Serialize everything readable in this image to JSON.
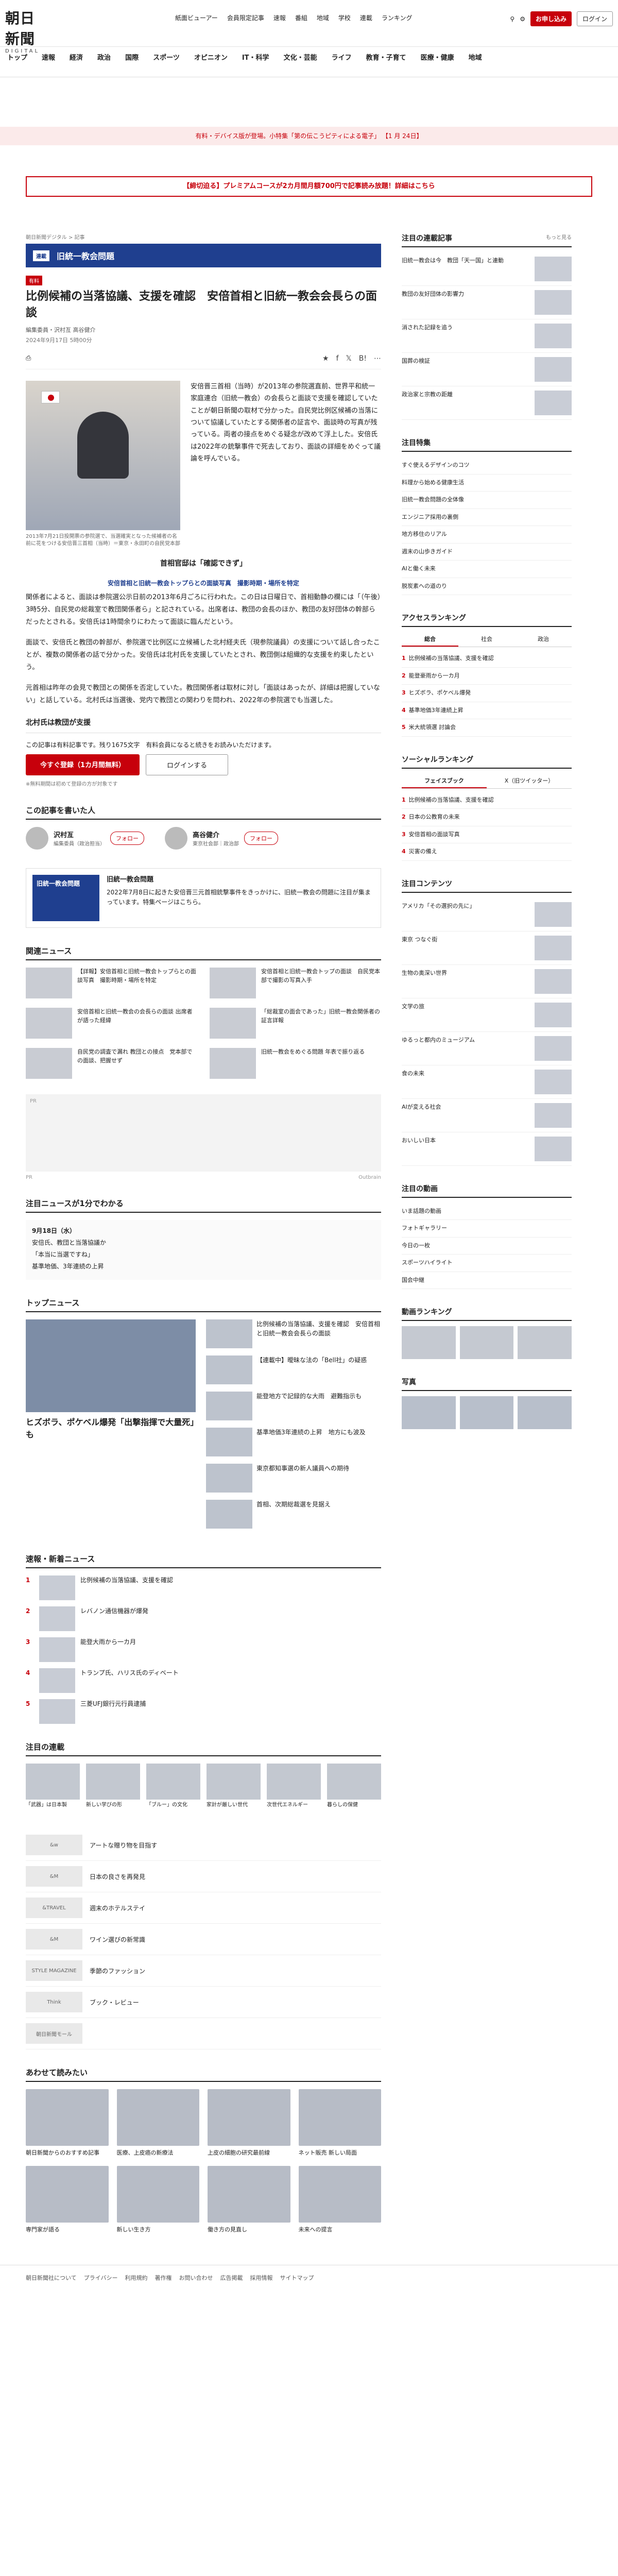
{
  "header": {
    "logo_main": "朝日新聞",
    "logo_sub": "DIGITAL",
    "upper_nav": [
      "紙面ビューアー",
      "会員限定記事",
      "速報",
      "番組",
      "地域",
      "学校",
      "連載",
      "ランキング"
    ],
    "subscribe_label": "お申し込み",
    "login_label": "ログイン",
    "main_nav": [
      "トップ",
      "速報",
      "経済",
      "政治",
      "国際",
      "スポーツ",
      "オピニオン",
      "IT・科学",
      "文化・芸能",
      "ライフ",
      "教育・子育て",
      "医療・健康",
      "地域"
    ]
  },
  "notice": "有料・デバイス版が登場。小特集「第の伝こうピティによる電子」 【1 月 24日】",
  "promo": "【締切迫る】プレミアムコースが2カ月間月額700円で記事読み放題！詳細はこちら",
  "article": {
    "crumb": "朝日新聞デジタル > 記事",
    "series_tag": "連載",
    "series_name": "旧統一教会問題",
    "lock_label": "有料",
    "headline": "比例候補の当落協議、支援を確認　安倍首相と旧統一教会会長らの面談",
    "byline": "編集委員・沢村亙 高谷健介",
    "meta": "2024年9月17日 5時00分",
    "photo_caption": "2013年7月21日投開票の参院選で、当選確実となった候補者の名前に花をつける安倍晋三首相（当時）＝東京・永田町の自民党本部",
    "lead": "安倍晋三首相（当時）が2013年の参院選直前、世界平和統一家庭連合（旧統一教会）の会長らと面談で支援を確認していたことが朝日新聞の取材で分かった。自民党比例区候補の当落について協議していたとする関係者の証言や、面談時の写真が残っている。両者の接点をめぐる疑念が改めて浮上した。安倍氏は2022年の銃撃事件で死去しており、面談の詳細をめぐって議論を呼んでいる。",
    "subhead_1": "首相官邸は「確認できず」",
    "subhead_2": "安倍首相と旧統一教会トップらとの面談写真　撮影時期・場所を特定",
    "para_1": "関係者によると、面談は参院選公示日前の2013年6月ごろに行われた。この日は日曜日で、首相動静の欄には「（午後）3時5分、自民党の総裁室で教団関係者ら」と記されている。出席者は、教団の会長のほか、教団の友好団体の幹部らだったとされる。安倍氏は1時間余りにわたって面談に臨んだという。",
    "para_2": "面談で、安倍氏と教団の幹部が、参院選で比例区に立候補した北村経夫氏（現参院議員）の支援について話し合ったことが、複数の関係者の話で分かった。安倍氏は北村氏を支援していたとされ、教団側は組織的な支援を約束したという。",
    "para_3": "元首相は昨年の会見で教団との関係を否定していた。教団関係者は取材に対し「面談はあったが、詳細は把握していない」と話している。北村氏は当選後、党内で教団との関わりを問われ、2022年の参院選でも当選した。",
    "subhead_3": "北村氏は教団が支援",
    "paywall_msg": "この記事は有料記事です。残り1675文字　有料会員になると続きをお読みいただけます。",
    "subscribe_btn": "今すぐ登録（1カ月間無料）",
    "login_btn": "ログインする",
    "paywall_note": "※無料期間は初めて登録の方が対象です"
  },
  "authors": {
    "title": "この記事を書いた人",
    "list": [
      {
        "name": "沢村亙",
        "role": "編集委員（政治担当）",
        "follow": "フォロー"
      },
      {
        "name": "高谷健介",
        "role": "東京社会部｜政治部",
        "follow": "フォロー"
      }
    ]
  },
  "series_box": {
    "thumb": "旧統一教会問題",
    "title": "旧統一教会問題",
    "text": "2022年7月8日に起きた安倍晋三元首相銃撃事件をきっかけに、旧統一教会の問題に注目が集まっています。特集ページはこちら。"
  },
  "related": {
    "title": "関連ニュース",
    "items": [
      "【詳報】安倍首相と旧統一教会トップらとの面談写真　撮影時期・場所を特定",
      "安倍首相と旧統一教会トップの面談　自民党本部で撮影の写真入手",
      "安倍首相と旧統一教会の会長らの面談 出席者が語った経緯",
      "「総裁室の面会であった」旧統一教会関係者の証言詳報",
      "自民党の調査で漏れ 教団との接点　党本部での面談、把握せず",
      "旧統一教会をめぐる問題 年表で振り返る"
    ]
  },
  "ad": {
    "label": "PR",
    "provider": "Outbrain"
  },
  "timeline": {
    "title": "注目ニュースが1分でわかる",
    "rows": [
      "9月18日（水）",
      "安倍氏、教団と当落協議か",
      "「本当に当選ですね」",
      "基準地価、3年連続の上昇"
    ]
  },
  "top_news": {
    "title": "トップニュース",
    "big_title": "ヒズボラ、ポケベル爆発「出撃指揮で大量死」も",
    "list": [
      "比例候補の当落協議、支援を確認　安倍首相と旧統一教会会長らの面談",
      "【連載中】曖昧な法の「Bell社」の疑惑",
      "能登地方で記録的な大雨　避難指示も",
      "基準地価3年連続の上昇　地方にも波及",
      "東京都知事選の新人議員への期待",
      "首相、次期総裁選を見据え"
    ]
  },
  "ranking": {
    "title": "速報・新着ニュース",
    "items": [
      "比例候補の当落協議、支援を確認",
      "レバノン通信機器が爆発",
      "能登大雨から一カ月",
      "トランプ氏、ハリス氏のディベート",
      "三菱UFJ銀行元行員逮捕"
    ]
  },
  "picks": {
    "title": "注目の連載",
    "items": [
      "「武器」は日本製",
      "新しい学びの形",
      "「ブルー」の文化",
      "家計が厳しい世代",
      "次世代エネルギー",
      "暮らしの保健"
    ]
  },
  "brands": [
    {
      "logo": "&w",
      "text": "アートな贈り物を目指す"
    },
    {
      "logo": "&M",
      "text": "日本の良さを再発見"
    },
    {
      "logo": "&TRAVEL",
      "text": "週末のホテルステイ"
    },
    {
      "logo": "&M",
      "text": "ワイン選びの新常識"
    },
    {
      "logo": "STYLE MAGAZINE",
      "text": "季節のファッション"
    },
    {
      "logo": "Think",
      "text": "ブック・レビュー"
    }
  ],
  "brand_footer": "朝日新聞モール",
  "recommend": {
    "title": "あわせて読みたい",
    "items": [
      "朝日新聞からのおすすめ記事",
      "医療、上皮癌の新療法",
      "上皮の細胞の研究最前線",
      "ネット販売 新しい局面",
      "専門家が語る",
      "新しい生き方",
      "働き方の見直し",
      "未来への提言"
    ]
  },
  "sidebar": {
    "popular_title": "注目の連載記事",
    "popular_more": "もっと見る",
    "popular": [
      "旧統一教会は今　教団「天一国」と連動",
      "教団の友好団体の影響力",
      "消された記録を追う",
      "国葬の検証",
      "政治家と宗教の距離"
    ],
    "feature_title": "注目特集",
    "features": [
      "すぐ使えるデザインのコツ",
      "料理から始める健康生活",
      "旧統一教会問題の全体像",
      "エンジニア採用の裏側",
      "地方移住のリアル",
      "週末の山歩きガイド",
      "AIと働く未来",
      "脱炭素への道のり"
    ],
    "access_title": "アクセスランキング",
    "access_tabs": [
      "総合",
      "社会",
      "政治"
    ],
    "access": [
      "比例候補の当落協議、支援を確認",
      "能登豪雨から一カ月",
      "ヒズボラ、ポケベル爆発",
      "基準地価3年連続上昇",
      "米大統領選 討論会"
    ],
    "social_title": "ソーシャルランキング",
    "social_tabs": [
      "フェイスブック",
      "X（旧ツイッター）"
    ],
    "social": [
      "比例候補の当落協議、支援を確認",
      "日本の公教育の未来",
      "安倍首相の面談写真",
      "災害の備え"
    ],
    "contents_title": "注目コンテンツ",
    "contents": [
      "アメリカ「その選択の先に」",
      "東京 つなぐ街",
      "生物の奥深い世界",
      "文学の旅",
      "ゆるっと都内のミュージアム",
      "食の未来",
      "AIが変える社会",
      "おいしい日本"
    ],
    "shopping_title": "注目の動画",
    "shopping": [
      "いま話題の動画",
      "フォトギャラリー",
      "今日の一枚",
      "スポーツハイライト",
      "国会中継"
    ],
    "video_title": "動画ランキング",
    "photo_title": "写真"
  },
  "footer": [
    "朝日新聞社について",
    "プライバシー",
    "利用規約",
    "著作権",
    "お問い合わせ",
    "広告掲載",
    "採用情報",
    "サイトマップ"
  ]
}
